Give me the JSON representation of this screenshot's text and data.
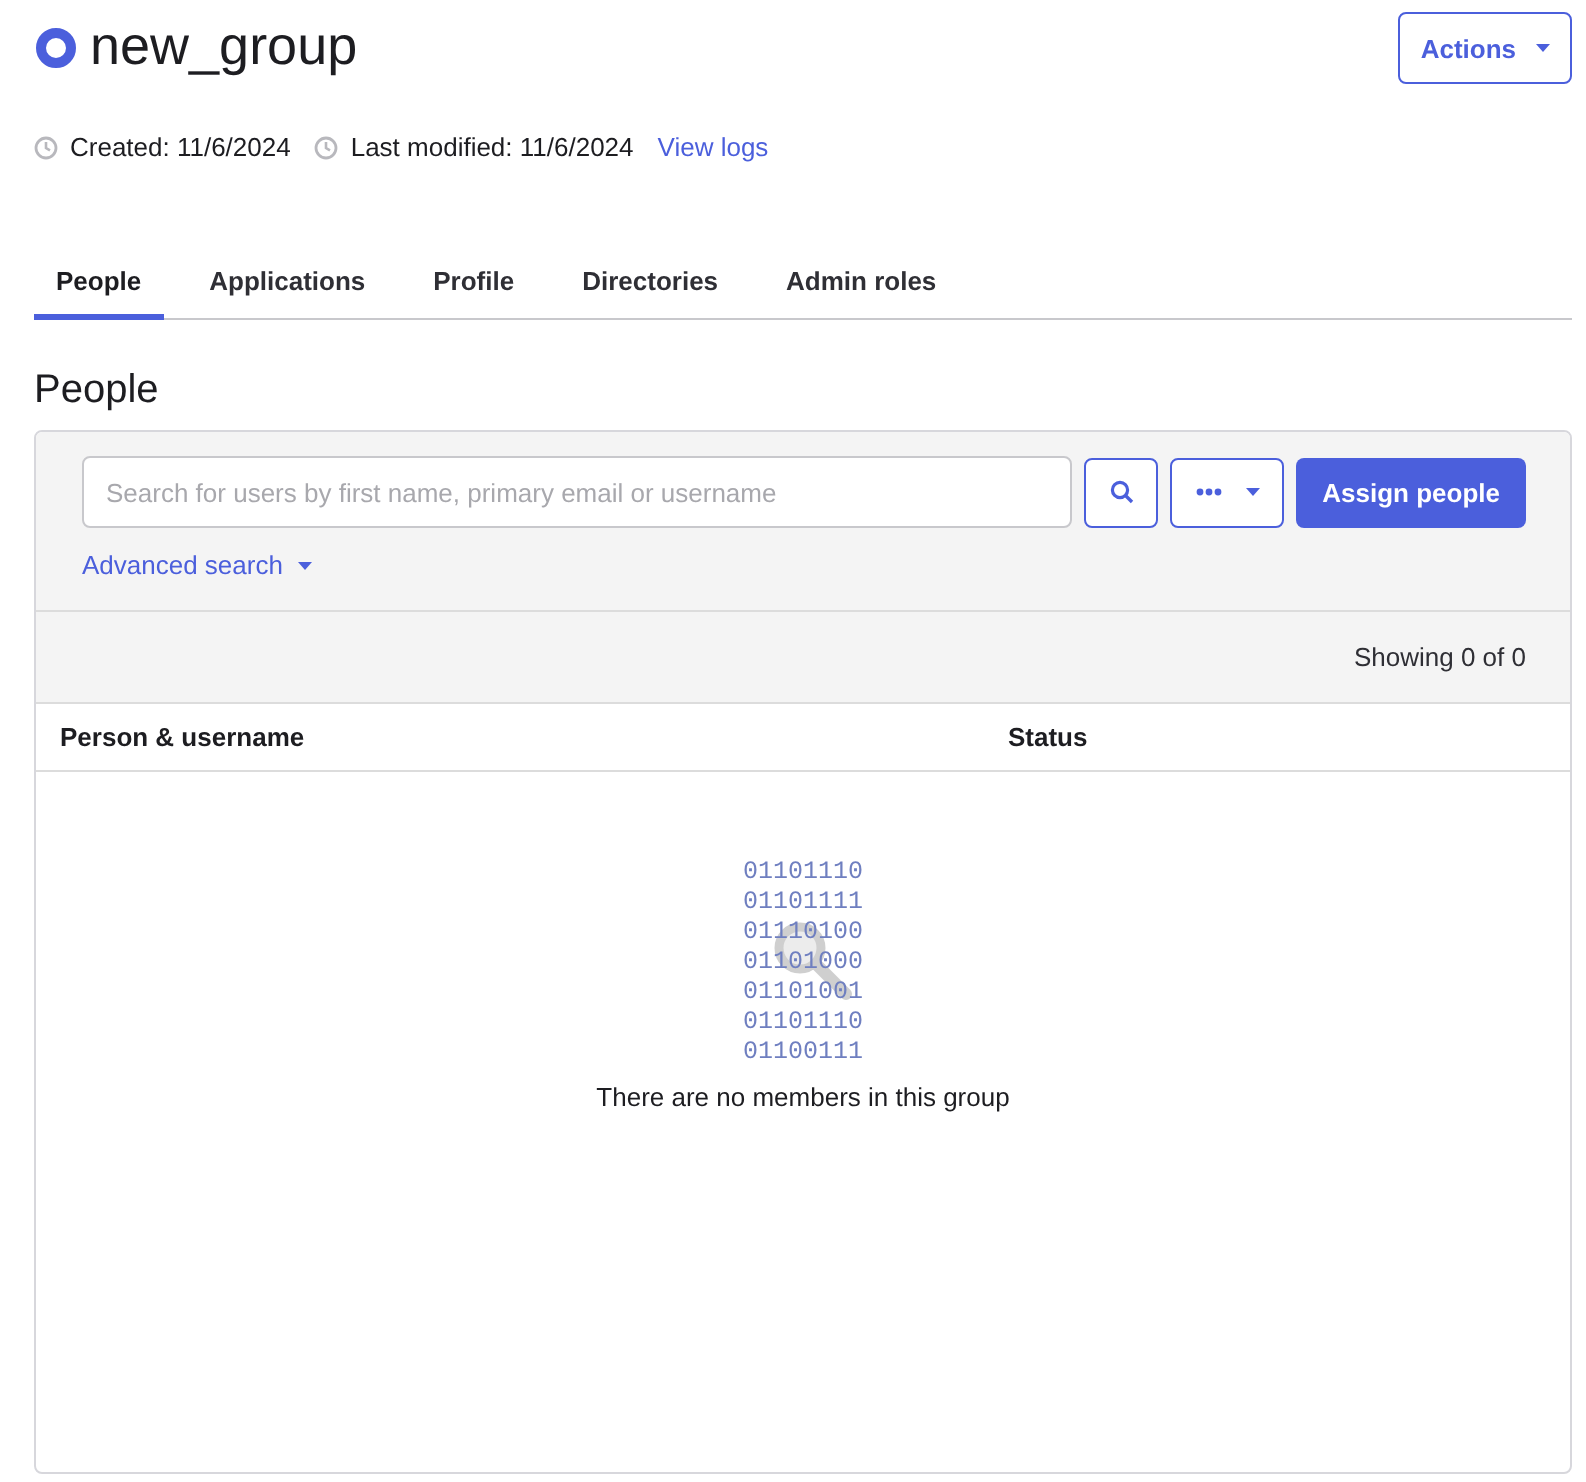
{
  "header": {
    "title": "new_group",
    "actions_button": "Actions"
  },
  "meta": {
    "created": "Created: 11/6/2024",
    "modified": "Last modified: 11/6/2024",
    "logs_link": "View logs"
  },
  "tabs": [
    {
      "label": "People",
      "selected": true
    },
    {
      "label": "Applications",
      "selected": false
    },
    {
      "label": "Profile",
      "selected": false
    },
    {
      "label": "Directories",
      "selected": false
    },
    {
      "label": "Admin roles",
      "selected": false
    }
  ],
  "section_title": "People",
  "search": {
    "placeholder": "Search for users by first name, primary email or username",
    "assign_button": "Assign people",
    "advanced_search": "Advanced search"
  },
  "showing": "Showing 0 of 0",
  "table": {
    "columns": [
      "Person & username",
      "Status"
    ]
  },
  "empty_state": {
    "binary_lines": [
      "01101110",
      "01101111",
      "01110100",
      "01101000",
      "01101001",
      "01101110",
      "01100111"
    ],
    "message": "There are no members in this group"
  }
}
